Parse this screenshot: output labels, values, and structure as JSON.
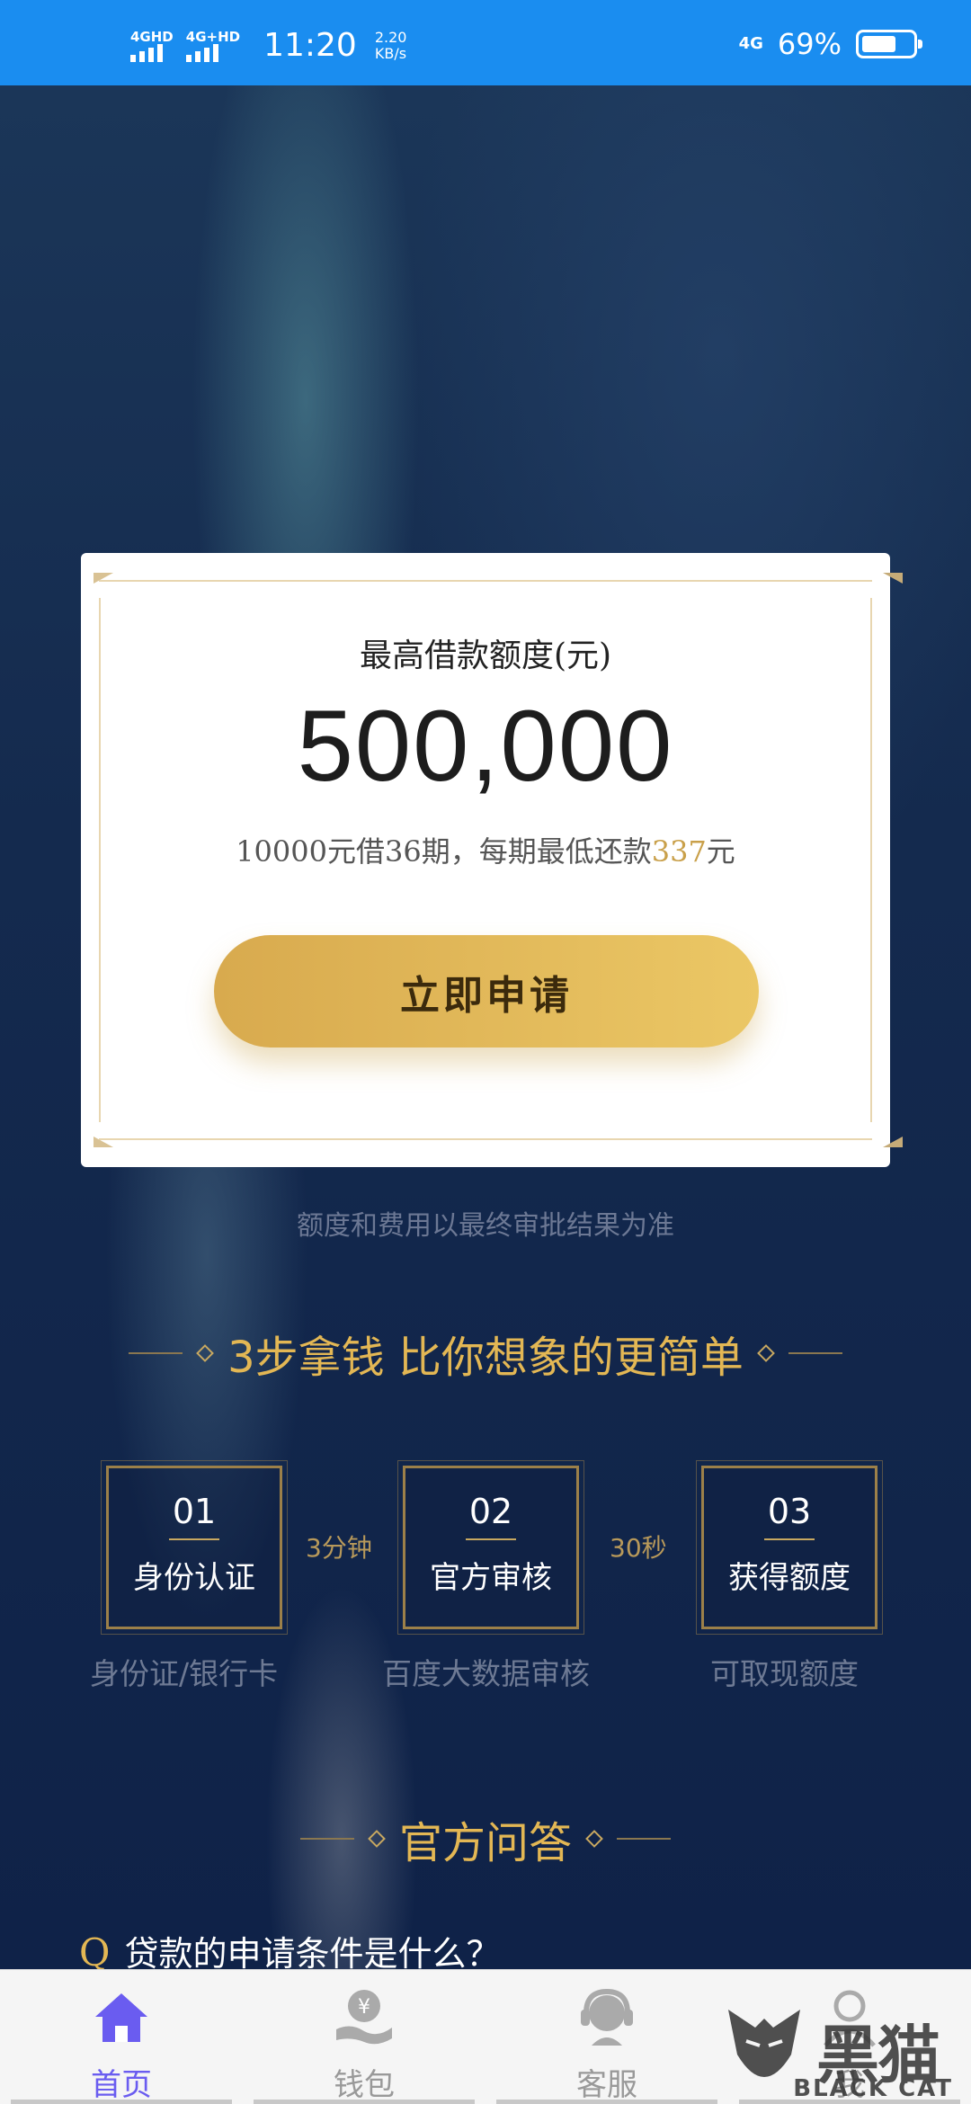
{
  "status_bar": {
    "sim1": "4GHD",
    "sim2": "4G+HD",
    "time": "11:20",
    "speed_value": "2.20",
    "speed_unit": "KB/s",
    "network": "4G",
    "battery_text": "69%",
    "battery_level": 0.69
  },
  "card": {
    "title": "最高借款额度(元)",
    "amount": "500,000",
    "sub_prefix": "10000元借36期，每期最低还款",
    "sub_highlight": "337",
    "sub_suffix": "元",
    "apply_label": "立即申请"
  },
  "disclaimer": "额度和费用以最终审批结果为准",
  "steps_section": {
    "title": "3步拿钱 比你想象的更简单",
    "steps": [
      {
        "num": "01",
        "label": "身份认证",
        "desc": "身份证/银行卡"
      },
      {
        "num": "02",
        "label": "官方审核",
        "desc": "百度大数据审核"
      },
      {
        "num": "03",
        "label": "获得额度",
        "desc": "可取现额度"
      }
    ],
    "notes": [
      "3分钟",
      "30秒"
    ]
  },
  "qa_section": {
    "title": "官方问答",
    "items": [
      {
        "q": "Q",
        "text": "贷款的申请条件是什么？"
      }
    ]
  },
  "bottom_nav": {
    "items": [
      {
        "label": "首页",
        "icon": "home-icon"
      },
      {
        "label": "钱包",
        "icon": "wallet-icon"
      },
      {
        "label": "客服",
        "icon": "customer-service-icon"
      },
      {
        "label": "我",
        "icon": "user-icon"
      }
    ]
  },
  "watermark": {
    "cn": "黑猫",
    "en": "BLACK CAT"
  },
  "colors": {
    "accent_gold": "#e3b754",
    "status_bar": "#1a8df0",
    "nav_active": "#6a5cf0"
  }
}
